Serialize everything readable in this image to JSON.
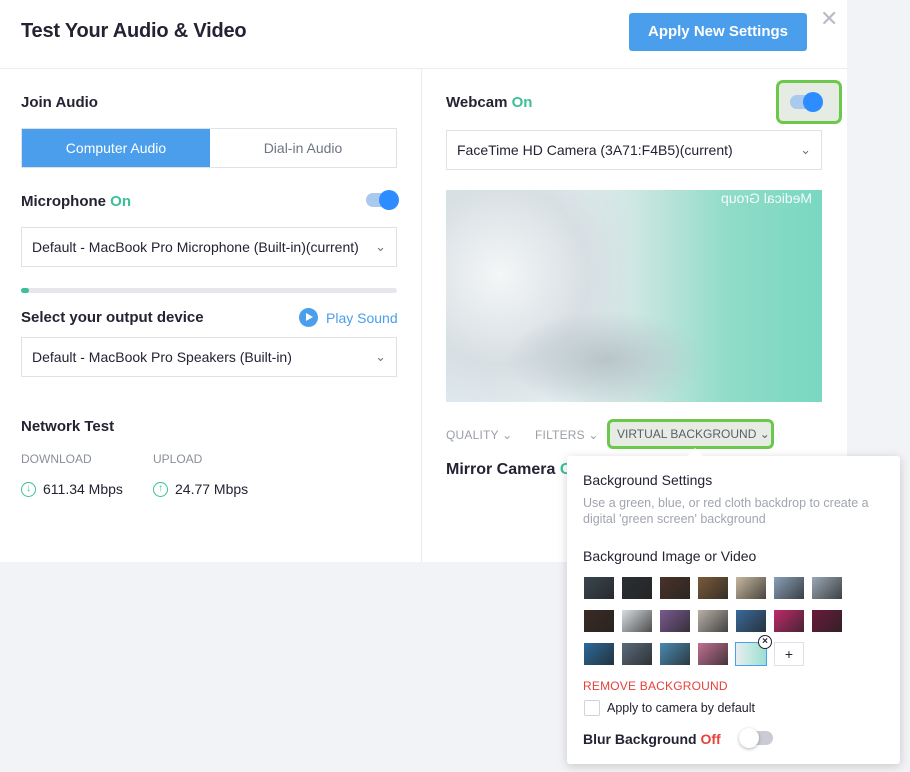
{
  "header": {
    "title": "Test Your Audio & Video",
    "apply_label": "Apply New Settings",
    "close_glyph": "✕"
  },
  "audio": {
    "join_label": "Join Audio",
    "tab_computer": "Computer Audio",
    "tab_dialin": "Dial-in Audio",
    "mic_label": "Microphone",
    "mic_state": "On",
    "mic_device": "Default - MacBook Pro Microphone (Built-in)(current)",
    "mic_level": 0.02,
    "output_label": "Select your output device",
    "play_label": "Play Sound",
    "output_device": "Default - MacBook Pro Speakers (Built-in)"
  },
  "network": {
    "title": "Network Test",
    "download_label": "DOWNLOAD",
    "download_value": "611.34 Mbps",
    "upload_label": "UPLOAD",
    "upload_value": "24.77 Mbps"
  },
  "video": {
    "webcam_label": "Webcam",
    "webcam_state": "On",
    "camera_device": "FaceTime HD Camera (3A71:F4B5)(current)",
    "preview_logo": "Medical Group",
    "tab_quality": "QUALITY",
    "tab_filters": "FILTERS",
    "tab_virtual": "VIRTUAL BACKGROUND",
    "mirror_label": "Mirror Camera",
    "mirror_state_partial": "O"
  },
  "background_popup": {
    "title": "Background Settings",
    "description": "Use a green, blue, or red cloth backdrop to create a digital 'green screen' background",
    "subtitle": "Background Image or Video",
    "add_label": "+",
    "remove_label": "REMOVE BACKGROUND",
    "apply_default_label": "Apply to camera by default",
    "blur_label": "Blur Background",
    "blur_state": "Off",
    "thumbnails": [
      [
        "#3a4550",
        "#2b2f33",
        "#4a3228",
        "#7a5a3a",
        "#c8b8a0",
        "#8aa0b8",
        "#9aa8b4"
      ],
      [
        "#3b2a22",
        "#d8dde0",
        "#7a5a90",
        "#b8b0a8",
        "#3a6a9a",
        "#c02a6a",
        "#6a1a3a"
      ],
      [
        "#2a6a9a",
        "#5a6a7a",
        "#4a8ab0",
        "#c07090",
        "#9ae0d0"
      ]
    ]
  },
  "colors": {
    "accent": "#4a9eec",
    "on": "#3cbf9a",
    "off": "#e8403b",
    "highlight": "#6cc84a"
  }
}
